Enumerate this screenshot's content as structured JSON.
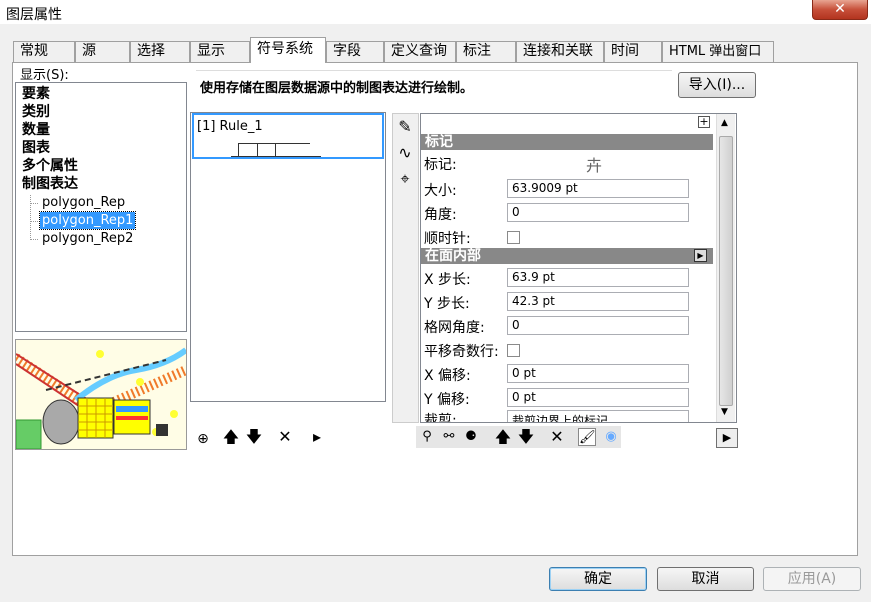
{
  "window": {
    "title": "图层属性",
    "close_glyph": "✕"
  },
  "tabs": [
    {
      "label": "常规"
    },
    {
      "label": "源"
    },
    {
      "label": "选择"
    },
    {
      "label": "显示"
    },
    {
      "label": "符号系统"
    },
    {
      "label": "字段"
    },
    {
      "label": "定义查询"
    },
    {
      "label": "标注"
    },
    {
      "label": "连接和关联"
    },
    {
      "label": "时间"
    },
    {
      "label": "HTML 弹出窗口"
    }
  ],
  "show_label": "显示(S):",
  "tree": {
    "items": [
      {
        "label": "要素"
      },
      {
        "label": "类别"
      },
      {
        "label": "数量"
      },
      {
        "label": "图表"
      },
      {
        "label": "多个属性"
      },
      {
        "label": "制图表达"
      }
    ],
    "sub_items": [
      {
        "label": "polygon_Rep"
      },
      {
        "label": "polygon_Rep1"
      },
      {
        "label": "polygon_Rep2"
      }
    ]
  },
  "description": "使用存储在图层数据源中的制图表达进行绘制。",
  "import_button": "导入(I)...",
  "rules": [
    {
      "label": "[1] Rule_1"
    }
  ],
  "properties": {
    "marker_section": "标记",
    "marker_label": "标记:",
    "size_label": "大小:",
    "size_value": "63.9009 pt",
    "angle_label": "角度:",
    "angle_value": "0",
    "clockwise_label": "顺时针:",
    "interior_section": "在面内部",
    "x_step_label": "X 步长:",
    "x_step_value": "63.9 pt",
    "y_step_label": "Y 步长:",
    "y_step_value": "42.3 pt",
    "grid_angle_label": "格网角度:",
    "grid_angle_value": "0",
    "shift_odd_label": "平移奇数行:",
    "x_offset_label": "X 偏移:",
    "x_offset_value": "0 pt",
    "y_offset_label": "Y 偏移:",
    "y_offset_value": "0 pt",
    "clip_label": "裁剪:",
    "clip_value": "裁剪边界上的标记"
  },
  "footer": {
    "ok": "确定",
    "cancel": "取消",
    "apply": "应用(A)"
  },
  "colors": {
    "selection": "#3399ff",
    "section_header": "#888888",
    "close_button": "#c7503a"
  }
}
